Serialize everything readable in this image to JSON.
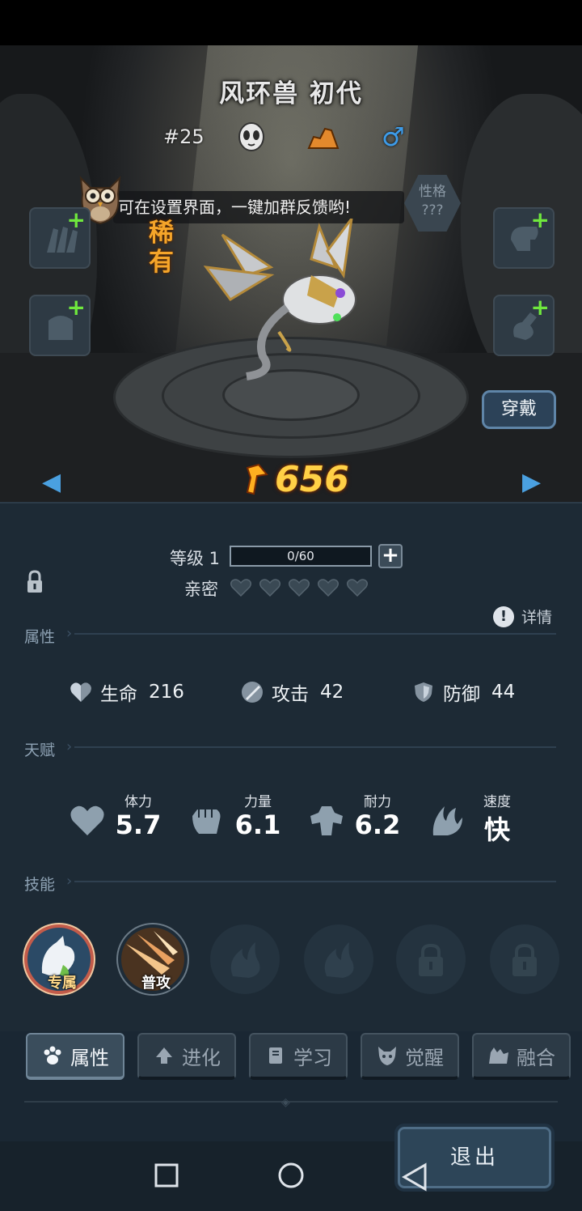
{
  "pet": {
    "name": "风环兽 初代",
    "number": "#25",
    "rarity": "稀有",
    "power": "656",
    "gender_symbol": "♂"
  },
  "tip": {
    "text": "可在设置界面，一键加群反馈哟!"
  },
  "personality": {
    "label": "性格",
    "value": "???"
  },
  "equip_button": "穿戴",
  "level": {
    "label": "等级 1",
    "xp_text": "0/60",
    "xp_progress": 0
  },
  "intimacy": {
    "label": "亲密",
    "hearts_filled": 0,
    "hearts_total": 5
  },
  "details_label": "详情",
  "sections": {
    "attributes": "属性",
    "talents": "天赋",
    "skills": "技能"
  },
  "stats": {
    "hp": {
      "label": "生命",
      "value": "216"
    },
    "attack": {
      "label": "攻击",
      "value": "42"
    },
    "defense": {
      "label": "防御",
      "value": "44"
    }
  },
  "talents": {
    "stamina": {
      "label": "体力",
      "value": "5.7"
    },
    "strength": {
      "label": "力量",
      "value": "6.1"
    },
    "endurance": {
      "label": "耐力",
      "value": "6.2"
    },
    "speed": {
      "label": "速度",
      "value": "快"
    }
  },
  "skills": {
    "exclusive_label": "专属",
    "basic_label": "普攻"
  },
  "tabs": [
    "属性",
    "进化",
    "学习",
    "觉醒",
    "融合"
  ],
  "exit_button": "退出",
  "colors": {
    "panel_bg": "#1d2a35",
    "power": "#ffd046",
    "rarity": "#f5a52a",
    "equip_plus": "#6fe83d",
    "gender": "#3d9be8"
  }
}
